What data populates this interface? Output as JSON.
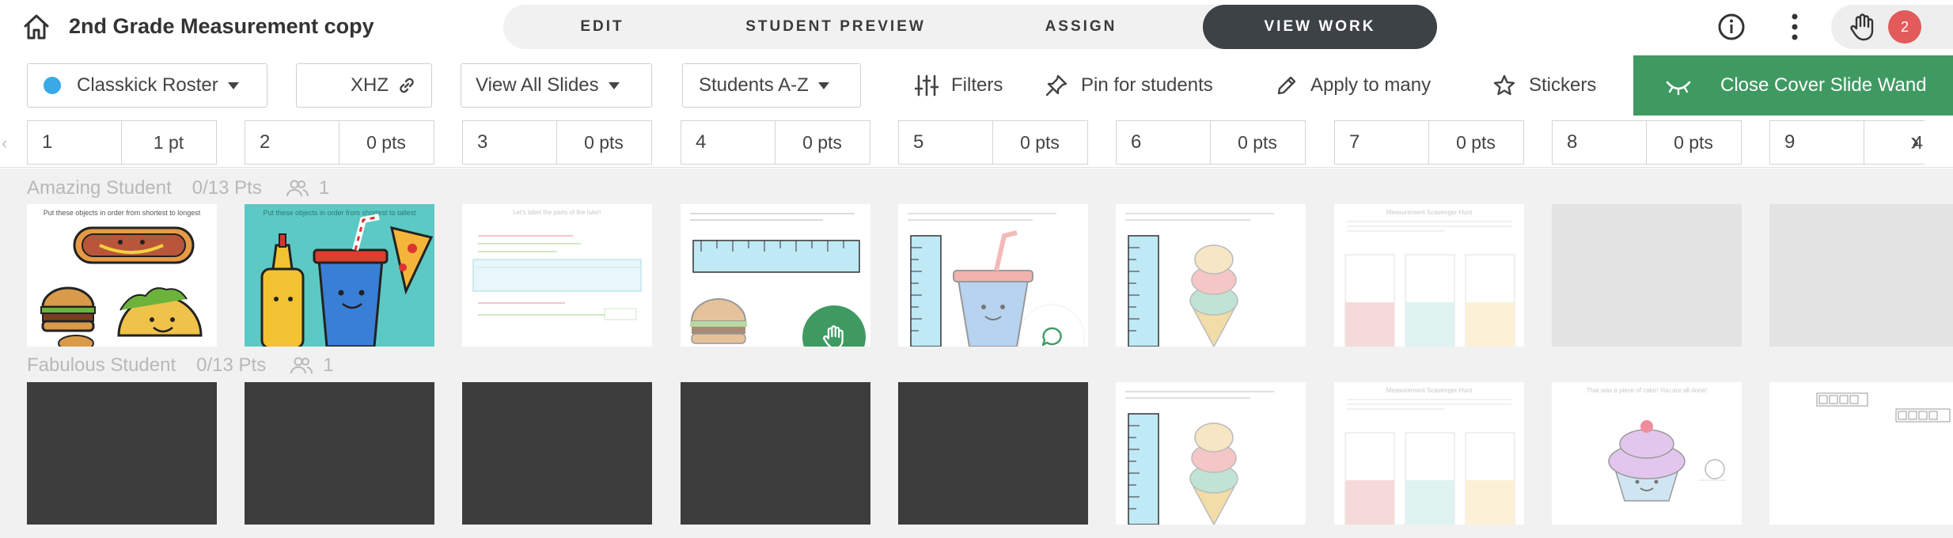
{
  "header": {
    "title": "2nd Grade Measurement copy",
    "tabs": [
      {
        "label": "EDIT",
        "active": false
      },
      {
        "label": "STUDENT PREVIEW",
        "active": false
      },
      {
        "label": "ASSIGN",
        "active": false
      },
      {
        "label": "VIEW WORK",
        "active": true
      }
    ],
    "badge_count": "2",
    "icons": {
      "home": "home-icon",
      "info": "info-icon",
      "more": "more-vertical-icon",
      "raise_hand": "hand-icon"
    }
  },
  "toolbar": {
    "roster": {
      "label": "Classkick Roster",
      "dot_color": "#3ba9e8"
    },
    "class_code": "XHZ",
    "slides_filter": "View All Slides",
    "sort": "Students A-Z",
    "filters_label": "Filters",
    "pin_label": "Pin for students",
    "apply_label": "Apply to many",
    "stickers_label": "Stickers",
    "close_cover_label": "Close Cover Slide Wand",
    "accent_color": "#3f9a61"
  },
  "slides": [
    {
      "num": "1",
      "pts": "1 pt"
    },
    {
      "num": "2",
      "pts": "0 pts"
    },
    {
      "num": "3",
      "pts": "0 pts"
    },
    {
      "num": "4",
      "pts": "0 pts"
    },
    {
      "num": "5",
      "pts": "0 pts"
    },
    {
      "num": "6",
      "pts": "0 pts"
    },
    {
      "num": "7",
      "pts": "0 pts"
    },
    {
      "num": "8",
      "pts": "0 pts"
    },
    {
      "num": "9",
      "pts": "4"
    }
  ],
  "students": [
    {
      "name": "Amazing Student",
      "score": "0/13 Pts",
      "helpers": "1"
    },
    {
      "name": "Fabulous Student",
      "score": "0/13 Pts",
      "helpers": "1"
    }
  ],
  "thumb_texts": {
    "s1": "Put these objects in order from shortest to longest",
    "s2": "Put these objects in order from shortest to tallest",
    "s3": "Let's label the parts of the ruler!",
    "s7": "Measurement Scavenger Hunt",
    "s8": "That was a piece of cake! You are all done!"
  }
}
